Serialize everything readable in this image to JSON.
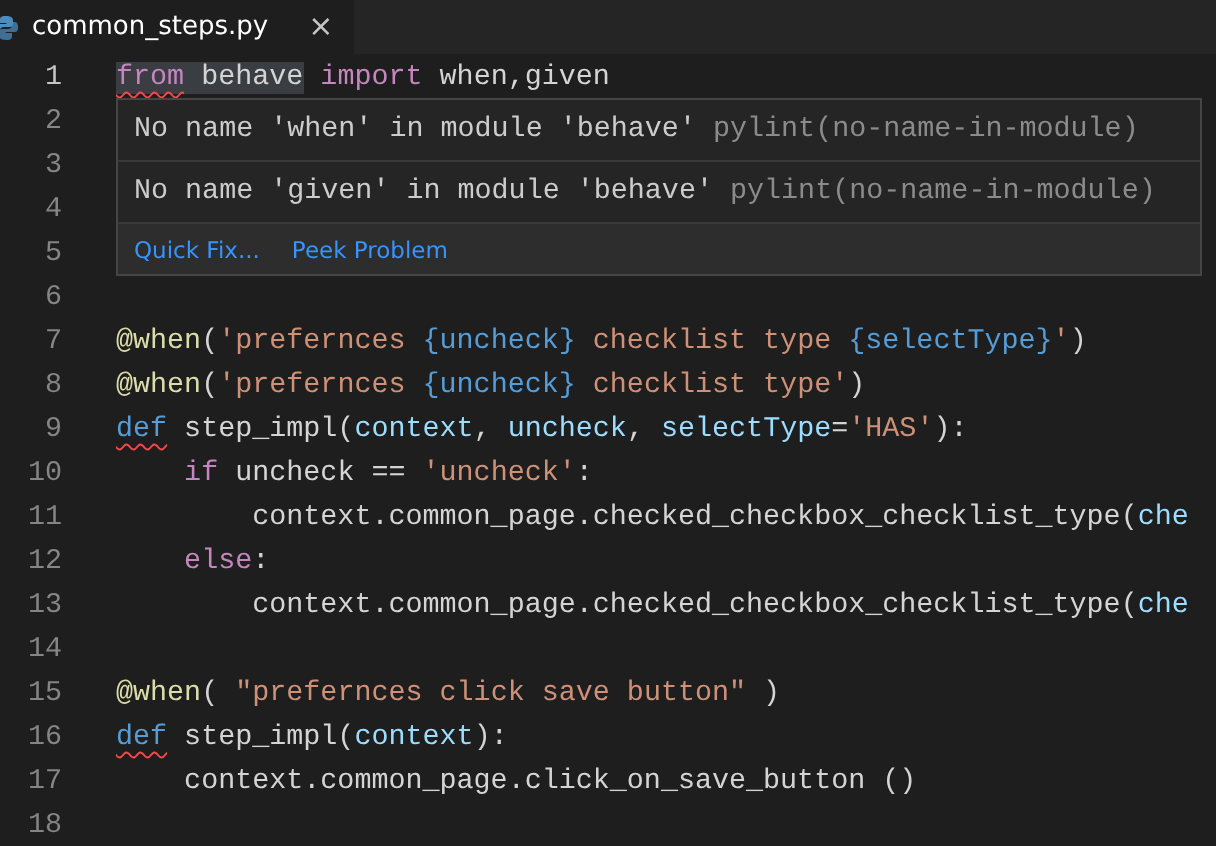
{
  "tabs": [
    {
      "label": "common_steps.py",
      "close": "×",
      "selected": true
    }
  ],
  "lines": [
    {
      "number": "1",
      "tokens": [
        {
          "text": "from",
          "kind": "keyword",
          "error": true,
          "highlight": true
        },
        {
          "text": " behave",
          "kind": "plain",
          "highlight": true
        },
        {
          "text": " import",
          "kind": "keyword"
        },
        {
          "text": " when,given",
          "kind": "plain"
        }
      ]
    },
    {
      "number": "2"
    },
    {
      "number": "3"
    },
    {
      "number": "4"
    },
    {
      "number": "5"
    },
    {
      "number": "6"
    },
    {
      "number": "7",
      "tokens": [
        {
          "text": "@when",
          "kind": "decorator"
        },
        {
          "text": "(",
          "kind": "plain"
        },
        {
          "text": "'prefernces ",
          "kind": "string"
        },
        {
          "text": "{uncheck}",
          "kind": "placeholder"
        },
        {
          "text": " checklist type ",
          "kind": "string"
        },
        {
          "text": "{selectType}",
          "kind": "placeholder"
        },
        {
          "text": "'",
          "kind": "string"
        },
        {
          "text": ")",
          "kind": "plain"
        }
      ]
    },
    {
      "number": "8",
      "tokens": [
        {
          "text": "@when",
          "kind": "decorator"
        },
        {
          "text": "(",
          "kind": "plain"
        },
        {
          "text": "'prefernces ",
          "kind": "string"
        },
        {
          "text": "{uncheck}",
          "kind": "placeholder"
        },
        {
          "text": " checklist type'",
          "kind": "string"
        },
        {
          "text": ")",
          "kind": "plain"
        }
      ]
    },
    {
      "number": "9",
      "tokens": [
        {
          "text": "def",
          "kind": "storage",
          "error": true
        },
        {
          "text": " step_impl(",
          "kind": "plain"
        },
        {
          "text": "context",
          "kind": "param"
        },
        {
          "text": ", ",
          "kind": "plain"
        },
        {
          "text": "uncheck",
          "kind": "param"
        },
        {
          "text": ", ",
          "kind": "plain"
        },
        {
          "text": "selectType",
          "kind": "param"
        },
        {
          "text": "=",
          "kind": "plain"
        },
        {
          "text": "'HAS'",
          "kind": "string"
        },
        {
          "text": "):",
          "kind": "plain"
        }
      ]
    },
    {
      "number": "10",
      "tokens": [
        {
          "text": "    if",
          "kind": "keyword"
        },
        {
          "text": " uncheck == ",
          "kind": "plain"
        },
        {
          "text": "'uncheck'",
          "kind": "string"
        },
        {
          "text": ":",
          "kind": "plain"
        }
      ]
    },
    {
      "number": "11",
      "tokens": [
        {
          "text": "        context.common_page.checked_checkbox_checklist_type(",
          "kind": "plain"
        },
        {
          "text": "che",
          "kind": "param"
        }
      ]
    },
    {
      "number": "12",
      "tokens": [
        {
          "text": "    else",
          "kind": "keyword"
        },
        {
          "text": ":",
          "kind": "plain"
        }
      ]
    },
    {
      "number": "13",
      "tokens": [
        {
          "text": "        context.common_page.checked_checkbox_checklist_type(",
          "kind": "plain"
        },
        {
          "text": "che",
          "kind": "param"
        }
      ]
    },
    {
      "number": "14"
    },
    {
      "number": "15",
      "tokens": [
        {
          "text": "@when",
          "kind": "decorator"
        },
        {
          "text": "( ",
          "kind": "plain"
        },
        {
          "text": "\"prefernces click save button\"",
          "kind": "string"
        },
        {
          "text": " )",
          "kind": "plain"
        }
      ]
    },
    {
      "number": "16",
      "tokens": [
        {
          "text": "def",
          "kind": "storage",
          "error": true
        },
        {
          "text": " step_impl(",
          "kind": "plain"
        },
        {
          "text": "context",
          "kind": "param"
        },
        {
          "text": "):",
          "kind": "plain"
        }
      ]
    },
    {
      "number": "17",
      "tokens": [
        {
          "text": "    context.common_page.click_on_save_button ()",
          "kind": "plain"
        }
      ]
    },
    {
      "number": "18"
    }
  ],
  "hover": {
    "problems": [
      {
        "message": "No name 'when' in module 'behave'",
        "source": "pylint(no-name-in-module)"
      },
      {
        "message": "No name 'given' in module 'behave'",
        "source": "pylint(no-name-in-module)"
      }
    ],
    "actions": [
      "Quick Fix...",
      "Peek Problem"
    ]
  }
}
